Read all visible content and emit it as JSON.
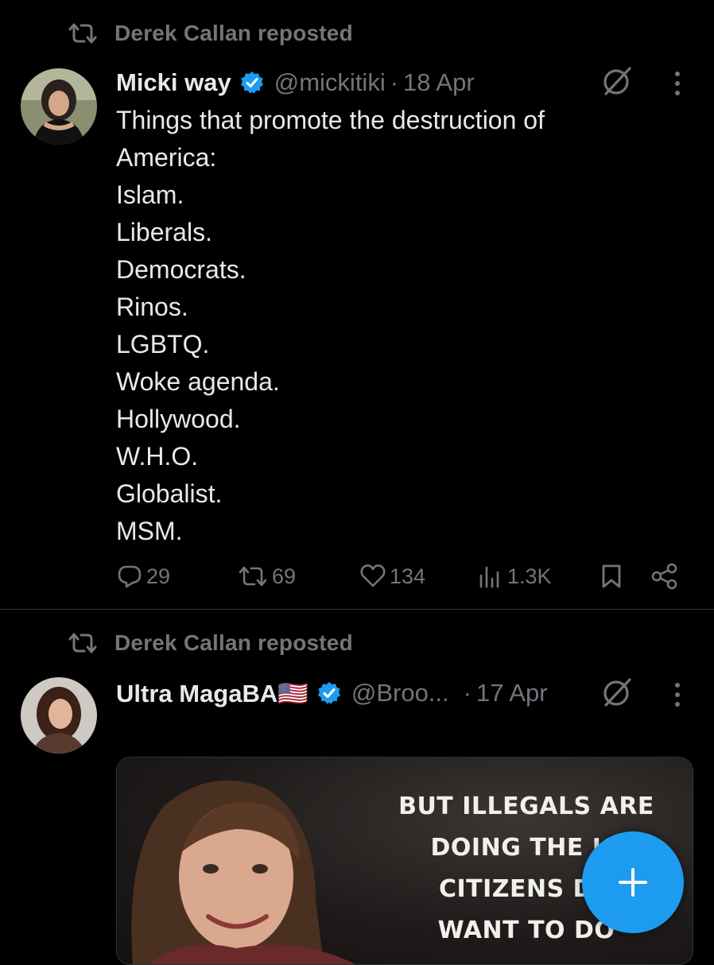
{
  "colors": {
    "background": "#000000",
    "text_primary": "#e7e9ea",
    "text_secondary": "#71767b",
    "accent_blue": "#1d9bf0",
    "divider": "#2f3336"
  },
  "tweets": [
    {
      "repost_label": "Derek Callan reposted",
      "author_name": "Micki way",
      "verified": true,
      "handle": "@mickitiki",
      "separator": "·",
      "timestamp": "18 Apr",
      "body_lines": [
        "Things that promote the destruction of",
        "America:",
        "Islam.",
        "Liberals.",
        "Democrats.",
        "Rinos.",
        "LGBTQ.",
        "Woke agenda.",
        "Hollywood.",
        "W.H.O.",
        "Globalist.",
        "MSM."
      ],
      "stats": {
        "replies": "29",
        "reposts": "69",
        "likes": "134",
        "views": "1.3K"
      }
    },
    {
      "repost_label": "Derek Callan reposted",
      "author_name": "Ultra MagaBA🇺🇸",
      "verified": true,
      "handle": "@Broo...",
      "separator": "·",
      "timestamp": "17 Apr",
      "media_caption_lines": [
        "BUT ILLEGALS ARE",
        "DOING THE JO",
        "CITIZENS DO",
        "WANT TO DO"
      ]
    }
  ],
  "icons": {
    "repost": "repost-icon",
    "verified": "verified-badge-icon",
    "grok": "grok-icon",
    "more": "more-vertical-icon",
    "reply": "reply-icon",
    "like": "heart-icon",
    "views": "views-icon",
    "bookmark": "bookmark-icon",
    "share": "share-icon",
    "compose": "plus-icon"
  }
}
